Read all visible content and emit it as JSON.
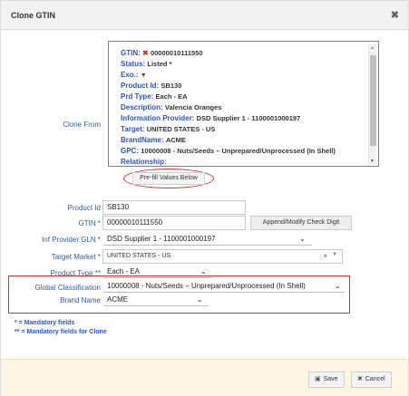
{
  "dialog": {
    "title": "Clone GTIN"
  },
  "labels": {
    "clone_from": "Clone From",
    "product_id": "Product Id",
    "gtin": "GTIN *",
    "inf_provider_gln": "Inf Provider GLN *",
    "target_market": "Target Market *",
    "product_type": "Product Type **",
    "global_classification": "Global Classification",
    "brand_name": "Brand Name"
  },
  "clone_info": {
    "gtin_key": "GTIN:",
    "gtin_val": "00000010111550",
    "status_key": "Status:",
    "status_val": "Listed *",
    "exo_key": "Exo.:",
    "product_id_key": "Product Id:",
    "product_id_val": "SB130",
    "prd_type_key": "Prd Type:",
    "prd_type_val": "Each - EA",
    "description_key": "Description:",
    "description_val": "Valencia Oranges",
    "info_provider_key": "Information Provider:",
    "info_provider_val": "DSD Supplier 1 - 1100001000197",
    "target_key": "Target:",
    "target_val": "UNITED STATES - US",
    "brandname_key": "BrandName:",
    "brandname_val": "ACME",
    "gpc_key": "GPC:",
    "gpc_val": "10000008 - Nuts/Seeds – Unprepared/Unprocessed (In Shell)",
    "relationship_key": "Relationship:"
  },
  "prefill_button": "Pre-fill Values Below",
  "fields": {
    "product_id": "SB130",
    "gtin": "00000010111550",
    "append_button": "Append/Modify Check Digit",
    "inf_provider_gln": "DSD Supplier 1 - 1100001000197",
    "target_market": "UNITED STATES - US",
    "product_type": "Each - EA",
    "global_classification": "10000008 - Nuts/Seeds – Unprepared/Unprocessed (In Shell)",
    "brand_name": "ACME"
  },
  "notes": {
    "mandatory": "* = Mandatory fields",
    "mandatory_clone": "** = Mandatory fields for Clone"
  },
  "footer": {
    "save": "Save",
    "cancel": "Cancel"
  }
}
